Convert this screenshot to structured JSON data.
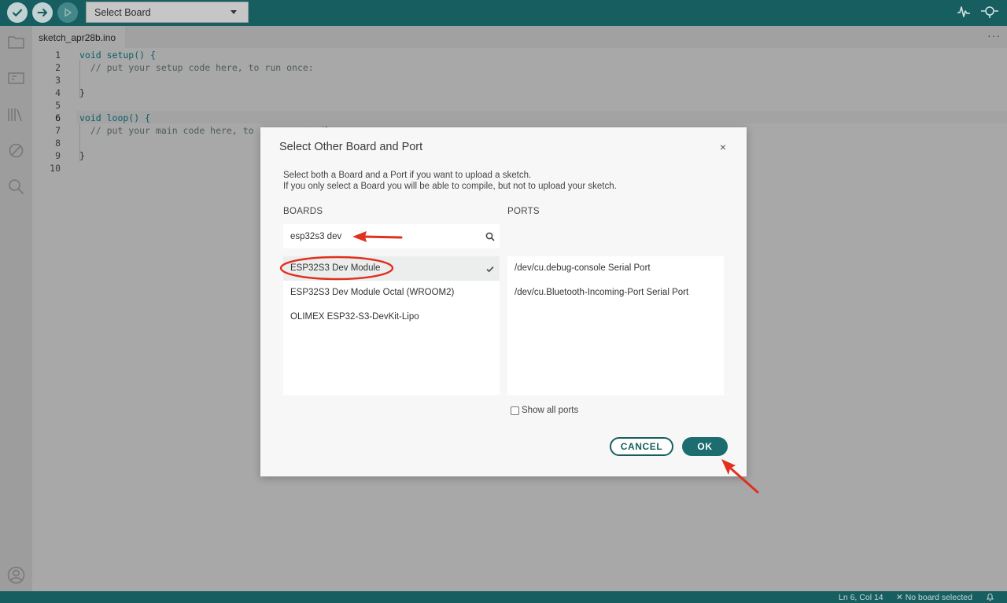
{
  "toolbar": {
    "board_select_label": "Select Board",
    "icons": [
      "verify-icon",
      "upload-icon",
      "debug-icon",
      "serial-plotter-icon",
      "serial-monitor-icon"
    ]
  },
  "sidebar": {
    "icons": [
      "sketchbook-icon",
      "boards-manager-icon",
      "library-manager-icon",
      "debug-icon",
      "search-icon",
      "profile-icon"
    ]
  },
  "tabs": {
    "active_label": "sketch_apr28b.ino",
    "more_label": "···"
  },
  "editor": {
    "lines": [
      {
        "num": "1",
        "text": "void setup() {"
      },
      {
        "num": "2",
        "text": "  // put your setup code here, to run once:"
      },
      {
        "num": "3",
        "text": ""
      },
      {
        "num": "4",
        "text": "}"
      },
      {
        "num": "5",
        "text": ""
      },
      {
        "num": "6",
        "text": "void loop() {"
      },
      {
        "num": "7",
        "text": "  // put your main code here, to run repeatedly:"
      },
      {
        "num": "8",
        "text": ""
      },
      {
        "num": "9",
        "text": "}"
      },
      {
        "num": "10",
        "text": ""
      }
    ],
    "current_line": "6"
  },
  "dialog": {
    "title": "Select Other Board and Port",
    "close_label": "×",
    "description_line1": "Select both a Board and a Port if you want to upload a sketch.",
    "description_line2": "If you only select a Board you will be able to compile, but not to upload your sketch.",
    "boards_label": "BOARDS",
    "ports_label": "PORTS",
    "search_value": "esp32s3 dev",
    "boards": [
      {
        "label": "ESP32S3 Dev Module",
        "selected": true
      },
      {
        "label": "ESP32S3 Dev Module Octal (WROOM2)",
        "selected": false
      },
      {
        "label": "OLIMEX ESP32-S3-DevKit-Lipo",
        "selected": false
      }
    ],
    "ports": [
      {
        "label": "/dev/cu.debug-console Serial Port"
      },
      {
        "label": "/dev/cu.Bluetooth-Incoming-Port Serial Port"
      }
    ],
    "show_all_ports_label": "Show all ports",
    "show_all_ports_checked": false,
    "cancel_label": "CANCEL",
    "ok_label": "OK"
  },
  "statusbar": {
    "position": "Ln 6, Col 14",
    "board_status": "✕ No board selected",
    "bell_icon": "bell-icon"
  },
  "colors": {
    "teal": "#175e61",
    "annotation_red": "#e0301e"
  }
}
